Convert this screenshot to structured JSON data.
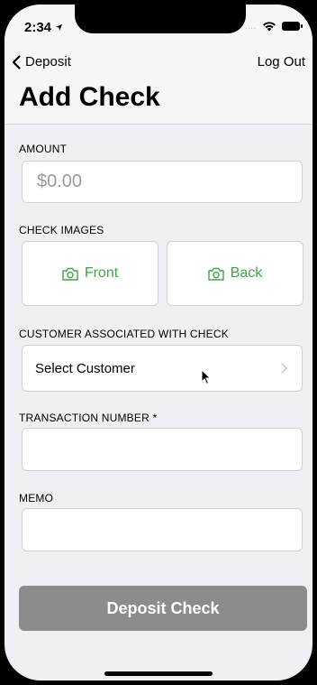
{
  "status_bar": {
    "time": "2:34",
    "signal": "...."
  },
  "nav": {
    "back_label": "Deposit",
    "logout_label": "Log Out",
    "title": "Add Check"
  },
  "amount": {
    "label": "AMOUNT",
    "placeholder": "$0.00"
  },
  "check_images": {
    "label": "CHECK IMAGES",
    "front_label": "Front",
    "back_label": "Back"
  },
  "customer": {
    "label": "CUSTOMER ASSOCIATED WITH CHECK",
    "value": "Select Customer"
  },
  "transaction": {
    "label": "TRANSACTION NUMBER *",
    "value": ""
  },
  "memo": {
    "label": "MEMO",
    "value": ""
  },
  "deposit_button": {
    "label": "Deposit Check"
  },
  "colors": {
    "accent_green": "#3fa64a",
    "button_gray": "#8c8c8c",
    "background": "#efeff4"
  }
}
